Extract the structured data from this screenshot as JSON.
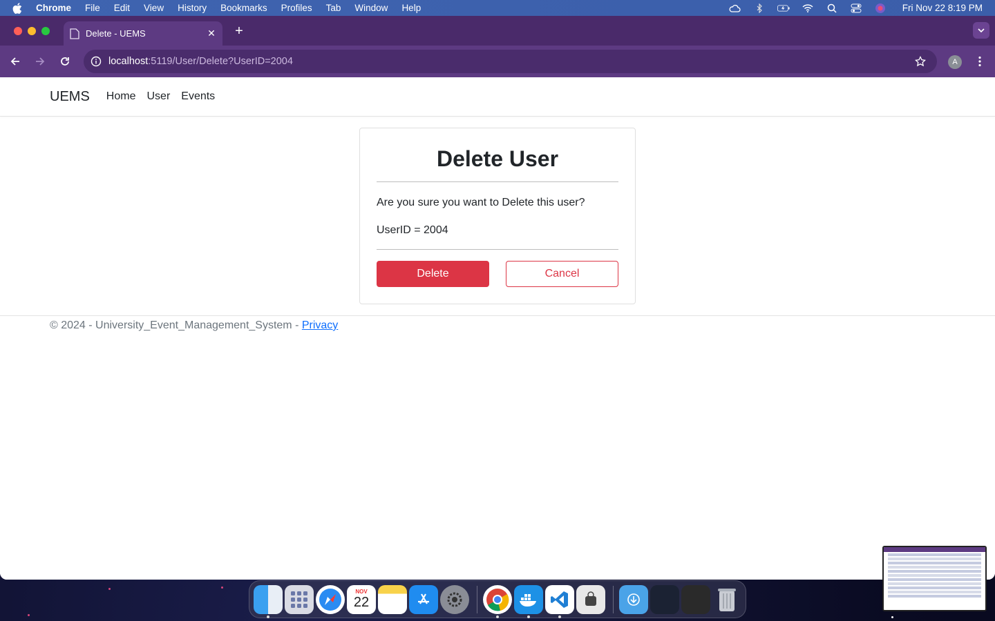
{
  "menubar": {
    "app_name": "Chrome",
    "items": [
      "File",
      "Edit",
      "View",
      "History",
      "Bookmarks",
      "Profiles",
      "Tab",
      "Window",
      "Help"
    ],
    "clock": "Fri Nov 22  8:19 PM"
  },
  "browser": {
    "tab_title": "Delete - UEMS",
    "url_host": "localhost",
    "url_path": ":5119/User/Delete?UserID=2004",
    "profile_initial": "A"
  },
  "navbar": {
    "brand": "UEMS",
    "links": [
      "Home",
      "User",
      "Events"
    ]
  },
  "card": {
    "title": "Delete User",
    "question": "Are you sure you want to Delete this user?",
    "user_id_text": "UserID = 2004",
    "delete_label": "Delete",
    "cancel_label": "Cancel"
  },
  "footer": {
    "text": "© 2024 - University_Event_Management_System - ",
    "privacy_label": "Privacy"
  },
  "dock": {
    "calendar_month": "NOV",
    "calendar_day": "22"
  },
  "colors": {
    "tabstrip": "#4a2a6a",
    "toolbar": "#5d3a82",
    "danger": "#dc3545",
    "link": "#0d6efd"
  }
}
